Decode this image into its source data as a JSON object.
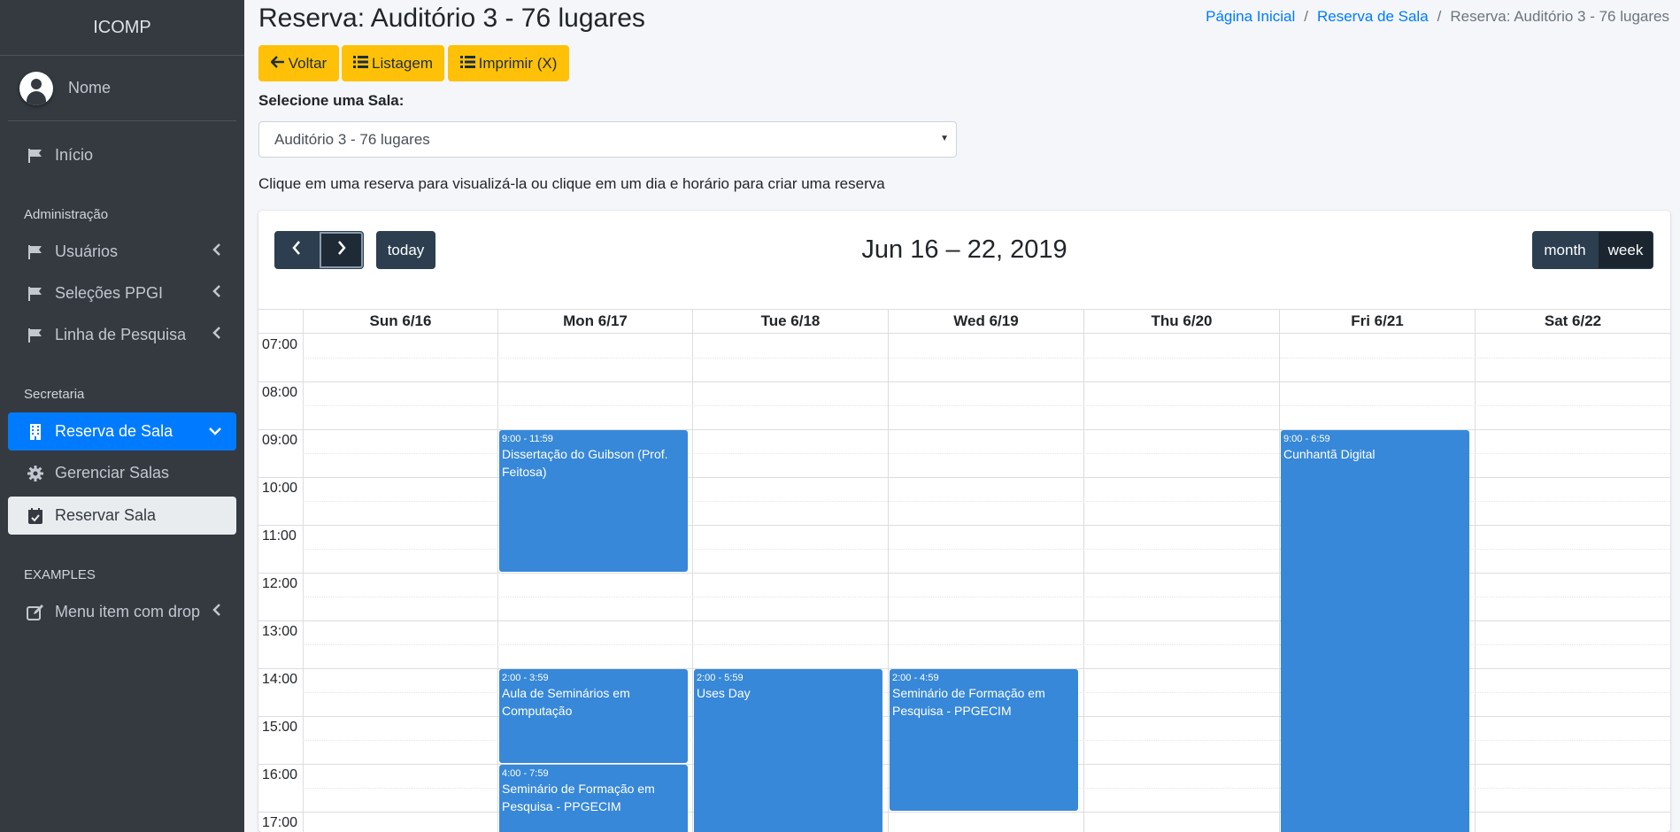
{
  "sidebar": {
    "brand": "ICOMP",
    "user_name": "Nome",
    "items": [
      {
        "label": "Início"
      },
      {
        "header": "Administração"
      },
      {
        "label": "Usuários"
      },
      {
        "label": "Seleções PPGI"
      },
      {
        "label": "Linha de Pesquisa"
      },
      {
        "header": "Secretaria"
      },
      {
        "label": "Reserva de Sala"
      },
      {
        "label": "Gerenciar Salas"
      },
      {
        "label": "Reservar Sala"
      },
      {
        "header": "EXAMPLES"
      },
      {
        "label": "Menu item com drop"
      }
    ]
  },
  "header": {
    "title": "Reserva: Auditório 3 - 76 lugares",
    "breadcrumb": [
      "Página Inicial",
      "Reserva de Sala",
      "Reserva: Auditório 3 - 76 lugares"
    ]
  },
  "toolbar": {
    "back_label": "Voltar",
    "list_label": "Listagem",
    "print_label": "Imprimir (X)"
  },
  "room_select": {
    "label": "Selecione uma Sala:",
    "value": "Auditório 3 - 76 lugares"
  },
  "hint": "Clique em uma reserva para visualizá-la ou clique em um dia e horário para criar uma reserva",
  "calendar": {
    "title": "Jun 16 – 22, 2019",
    "today_label": "today",
    "view_month": "month",
    "view_week": "week",
    "days": [
      "Sun 6/16",
      "Mon 6/17",
      "Tue 6/18",
      "Wed 6/19",
      "Thu 6/20",
      "Fri 6/21",
      "Sat 6/22"
    ],
    "times": [
      "07:00",
      "08:00",
      "09:00",
      "10:00",
      "11:00",
      "12:00",
      "13:00",
      "14:00",
      "15:00",
      "16:00",
      "17:00"
    ],
    "events": [
      {
        "time": "9:00 - 11:59",
        "title": "Dissertação do Guibson (Prof. Feitosa)"
      },
      {
        "time": "9:00 - 6:59",
        "title": "Cunhantã Digital"
      },
      {
        "time": "2:00 - 3:59",
        "title": "Aula de Seminários em Computação"
      },
      {
        "time": "2:00 - 5:59",
        "title": "Uses Day"
      },
      {
        "time": "2:00 - 4:59",
        "title": "Seminário de Formação em Pesquisa - PPGECIM"
      },
      {
        "time": "4:00 - 7:59",
        "title": "Seminário de Formação em Pesquisa - PPGECIM"
      }
    ]
  },
  "colors": {
    "sidebar_bg": "#343a40",
    "active_item": "#007bff",
    "warning_button": "#ffc107",
    "event": "#3788d8",
    "calendar_button": "#2c3e50"
  }
}
